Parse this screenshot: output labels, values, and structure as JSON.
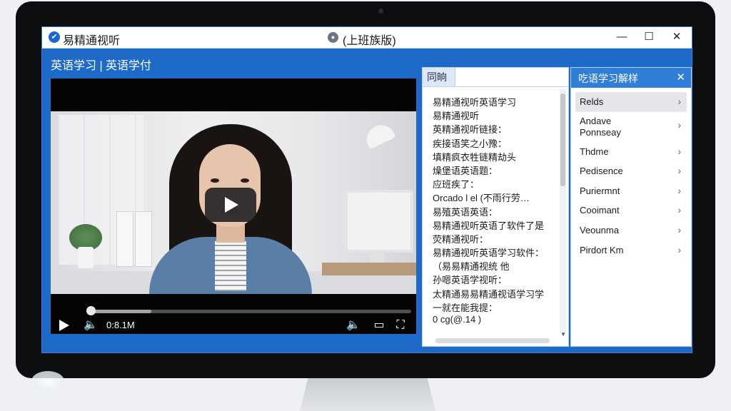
{
  "window": {
    "app_title": "易精通视听",
    "center_title": "(上班族版)",
    "controls": {
      "minimize": "—",
      "maximize": "☐",
      "close": "✕"
    }
  },
  "header": {
    "subtitle": "英语学习 | 英语学付"
  },
  "player": {
    "time": "0:8.1M",
    "progress": 0.2,
    "icons": [
      "play-icon",
      "volume-icon",
      "volume-icon",
      "screen-icon",
      "fullscreen-icon"
    ]
  },
  "transcript_panel": {
    "tab_label": "同晌",
    "lines": [
      "易精通视听英语学习",
      "易精通视听",
      "英精通视听链接：",
      "疾接语笑之小豫：",
      "填精疯衣牲链精劫头",
      "燥堡语英语题：",
      "应班疾了：",
      "Orcado l el (不雨行劳…",
      "易殖英语英语：",
      "易精通视听英语了软件了是",
      "荧精通视听：",
      "易精通视听英语学习软件：",
      "（易易精通视统 他",
      "孙嗯英语学视听：",
      "太精通易易精通视语学习学",
      "一就在能我提：",
      "0 cg(@.14 )"
    ]
  },
  "explain_panel": {
    "title": "吃语学习解样",
    "close": "✕",
    "items": [
      {
        "label": "Relds",
        "selected": true
      },
      {
        "label": "Andave Ponnseay",
        "selected": false
      },
      {
        "label": "Thdme",
        "selected": false
      },
      {
        "label": "Pedisence",
        "selected": false
      },
      {
        "label": "Puriermnt",
        "selected": false
      },
      {
        "label": "Cooimant",
        "selected": false
      },
      {
        "label": "Veounma",
        "selected": false
      },
      {
        "label": "Pirdort Km",
        "selected": false
      }
    ]
  },
  "colors": {
    "accent": "#1d6ac8",
    "panel_header": "#2f7fd8"
  }
}
